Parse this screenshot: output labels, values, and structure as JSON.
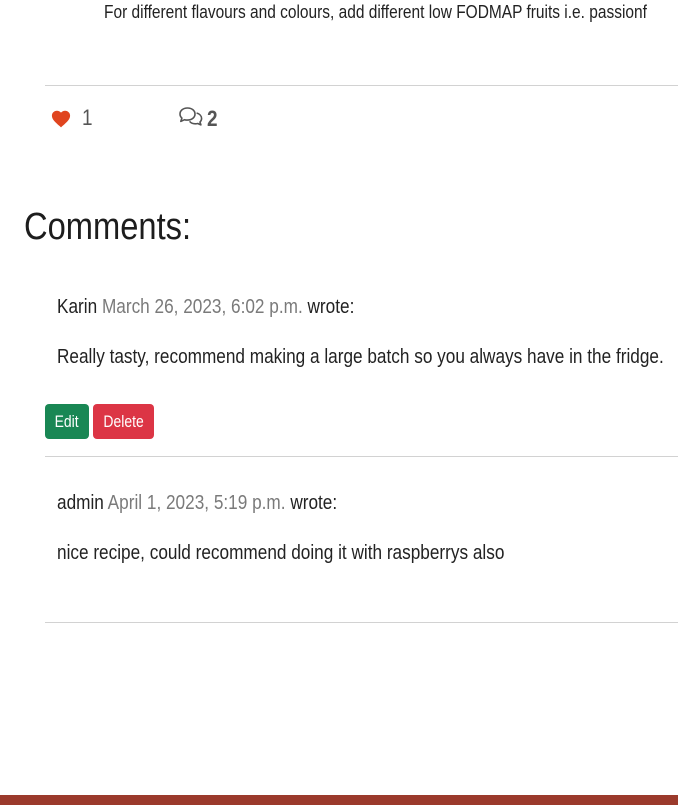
{
  "post": {
    "tip_text": "For different flavours and colours, add different low FODMAP fruits i.e. passionf"
  },
  "stats": {
    "like_count": "1",
    "comment_count": "2",
    "heart_color": "#e0451f"
  },
  "comments_section": {
    "heading": "Comments:",
    "comments": [
      {
        "author": "Karin",
        "date": "March 26, 2023, 6:02 p.m.",
        "wrote": "wrote:",
        "body": "Really tasty, recommend making a large batch so you always have in the fridge.",
        "edit_label": "Edit",
        "delete_label": "Delete"
      },
      {
        "author": "admin",
        "date": "April 1, 2023, 5:19 p.m.",
        "wrote": "wrote:",
        "body": "nice recipe, could recommend doing it with raspberrys also"
      }
    ]
  },
  "colors": {
    "edit_button": "#198754",
    "delete_button": "#dc3545",
    "footer": "#9b3a2c"
  }
}
